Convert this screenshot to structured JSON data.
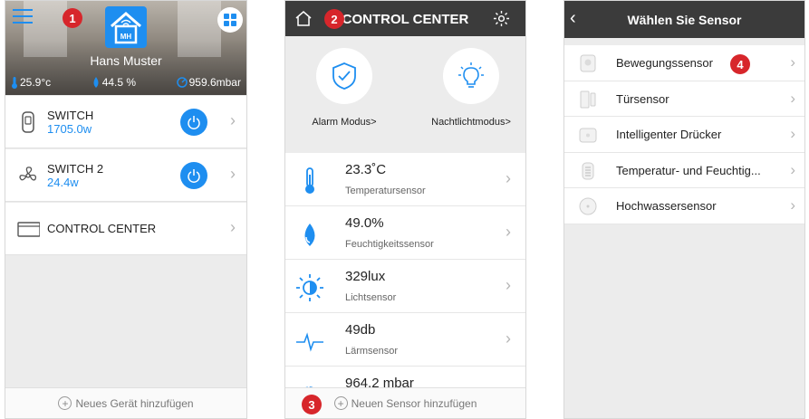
{
  "screen1": {
    "user_name": "Hans Muster",
    "logo_text": "MH",
    "stats": {
      "temperature": "25.9°c",
      "humidity": "44.5 %",
      "pressure": "959.6mbar"
    },
    "devices": [
      {
        "name": "SWITCH",
        "value": "1705.0w",
        "icon": "plug-icon"
      },
      {
        "name": "SWITCH 2",
        "value": "24.4w",
        "icon": "fan-icon"
      },
      {
        "name": "CONTROL CENTER",
        "value": "",
        "icon": "control-box-icon"
      }
    ],
    "footer_label": "Neues Gerät hinzufügen",
    "badge": "1"
  },
  "screen2": {
    "title": "CONTROL CENTER",
    "badge_top": "2",
    "badge_bottom": "3",
    "modes": [
      {
        "label": "Alarm Modus>",
        "icon": "shield-icon"
      },
      {
        "label": "Nachtlichtmodus>",
        "icon": "bulb-icon"
      }
    ],
    "sensors": [
      {
        "value": "23.3˚C",
        "name": "Temperatursensor",
        "icon": "thermometer-icon"
      },
      {
        "value": "49.0%",
        "name": "Feuchtigkeitssensor",
        "icon": "droplet-icon"
      },
      {
        "value": "329lux",
        "name": "Lichtsensor",
        "icon": "sun-icon"
      },
      {
        "value": "49db",
        "name": "Lärmsensor",
        "icon": "waveform-icon"
      },
      {
        "value": "964.2 mbar",
        "name": "",
        "icon": "gauge-icon"
      }
    ],
    "footer_label": "Neuen Sensor hinzufügen"
  },
  "screen3": {
    "title": "Wählen Sie Sensor",
    "badge": "4",
    "items": [
      {
        "label": "Bewegungssensor",
        "icon": "motion-sensor-icon"
      },
      {
        "label": "Türsensor",
        "icon": "door-sensor-icon"
      },
      {
        "label": "Intelligenter Drücker",
        "icon": "pusher-icon"
      },
      {
        "label": "Temperatur- und Feuchtig...",
        "icon": "temp-humidity-sensor-icon"
      },
      {
        "label": "Hochwassersensor",
        "icon": "water-sensor-icon"
      }
    ]
  },
  "colors": {
    "accent": "#1e8ef0",
    "header": "#3b3b3b",
    "badge": "#d7262b",
    "background": "#ececec"
  }
}
